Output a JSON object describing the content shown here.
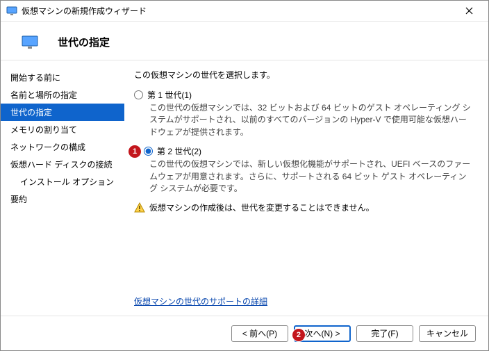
{
  "window": {
    "title": "仮想マシンの新規作成ウィザード",
    "page_title": "世代の指定"
  },
  "sidebar": {
    "steps": [
      {
        "label": "開始する前に"
      },
      {
        "label": "名前と場所の指定"
      },
      {
        "label": "世代の指定",
        "selected": true
      },
      {
        "label": "メモリの割り当て"
      },
      {
        "label": "ネットワークの構成"
      },
      {
        "label": "仮想ハード ディスクの接続"
      },
      {
        "label": "インストール オプション",
        "indent": true
      },
      {
        "label": "要約"
      }
    ]
  },
  "content": {
    "intro": "この仮想マシンの世代を選択します。",
    "gen1": {
      "label": "第 1 世代(1)",
      "desc": "この世代の仮想マシンでは、32 ビットおよび 64 ビットのゲスト オペレーティング システムがサポートされ、以前のすべてのバージョンの Hyper-V で使用可能な仮想ハードウェアが提供されます。"
    },
    "gen2": {
      "label": "第 2 世代(2)",
      "desc": "この世代の仮想マシンでは、新しい仮想化機能がサポートされ、UEFI ベースのファームウェアが用意されます。さらに、サポートされる 64 ビット ゲスト オペレーティング システムが必要です。"
    },
    "warning": "仮想マシンの作成後は、世代を変更することはできません。",
    "details_link": "仮想マシンの世代のサポートの詳細"
  },
  "buttons": {
    "back": "< 前へ(P)",
    "next": "次へ(N) >",
    "finish": "完了(F)",
    "cancel": "キャンセル"
  },
  "callouts": {
    "one": "1",
    "two": "2"
  }
}
